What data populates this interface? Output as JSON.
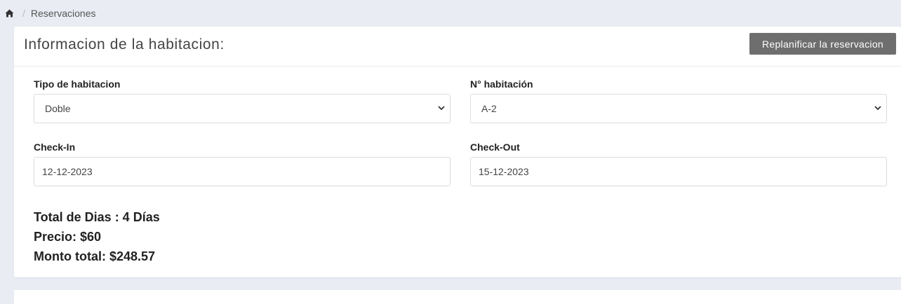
{
  "breadcrumb": {
    "home_icon": "home-icon",
    "separator": "/",
    "current": "Reservaciones"
  },
  "card": {
    "title": "Informacion de la habitacion:",
    "replan_button": "Replanificar la reservacion"
  },
  "form": {
    "room_type": {
      "label": "Tipo de habitacion",
      "value": "Doble"
    },
    "room_number": {
      "label": "N° habitación",
      "value": "A-2"
    },
    "check_in": {
      "label": "Check-In",
      "value": "12-12-2023"
    },
    "check_out": {
      "label": "Check-Out",
      "value": "15-12-2023"
    }
  },
  "summary": {
    "total_days": "Total de Dias : 4 Días",
    "price": "Precio: $60",
    "total_amount": "Monto total: $248.57"
  },
  "colors": {
    "page_bg": "#e9ecf3",
    "button_bg": "#6e6e6e"
  }
}
